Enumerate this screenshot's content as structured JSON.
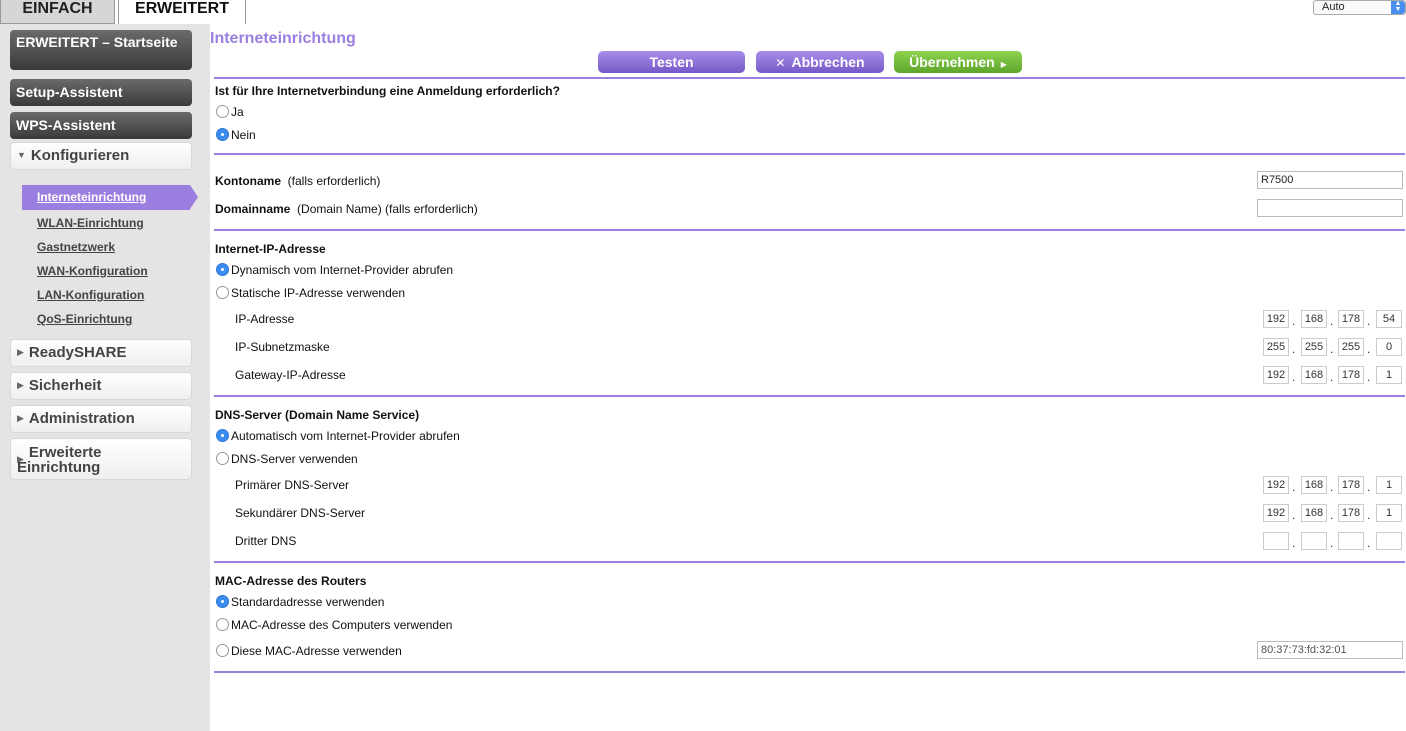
{
  "tabs": {
    "simple": "EINFACH",
    "advanced": "ERWEITERT"
  },
  "lang_select": {
    "value": "Auto"
  },
  "sidebar": {
    "home": "ERWEITERT – Startseite",
    "setup": "Setup-Assistent",
    "wps": "WPS-Assistent",
    "configure": "Konfigurieren",
    "sub": [
      "Interneteinrichtung",
      "WLAN-Einrichtung",
      "Gastnetzwerk",
      "WAN-Konfiguration",
      "LAN-Konfiguration",
      "QoS-Einrichtung"
    ],
    "readyshare": "ReadySHARE",
    "security": "Sicherheit",
    "admin": "Administration",
    "advanced_setup": "Erweiterte Einrichtung"
  },
  "page": {
    "title": "Interneteinrichtung",
    "btn_test": "Testen",
    "btn_cancel": "Abbrechen",
    "btn_apply": "Übernehmen",
    "login_q": "Ist für Ihre Internetverbindung eine Anmeldung erforderlich?",
    "yes": "Ja",
    "no": "Nein",
    "account_label": "Kontoname",
    "account_hint": "(falls erforderlich)",
    "account_value": "R7500",
    "domain_label": "Domainname",
    "domain_hint": "(Domain Name) (falls erforderlich)",
    "domain_value": "",
    "ip_title": "Internet-IP-Adresse",
    "ip_dynamic": "Dynamisch vom Internet-Provider abrufen",
    "ip_static": "Statische IP-Adresse verwenden",
    "ip_addr_label": "IP-Adresse",
    "ip_addr": [
      "192",
      "168",
      "178",
      "54"
    ],
    "ip_mask_label": "IP-Subnetzmaske",
    "ip_mask": [
      "255",
      "255",
      "255",
      "0"
    ],
    "gw_label": "Gateway-IP-Adresse",
    "gw": [
      "192",
      "168",
      "178",
      "1"
    ],
    "dns_title": "DNS-Server (Domain Name Service)",
    "dns_auto": "Automatisch vom Internet-Provider abrufen",
    "dns_manual": "DNS-Server verwenden",
    "dns1_label": "Primärer DNS-Server",
    "dns1": [
      "192",
      "168",
      "178",
      "1"
    ],
    "dns2_label": "Sekundärer DNS-Server",
    "dns2": [
      "192",
      "168",
      "178",
      "1"
    ],
    "dns3_label": "Dritter DNS",
    "dns3": [
      "",
      "",
      "",
      ""
    ],
    "mac_title": "MAC-Adresse des Routers",
    "mac_default": "Standardadresse verwenden",
    "mac_computer": "MAC-Adresse des Computers verwenden",
    "mac_custom": "Diese MAC-Adresse verwenden",
    "mac_value": "80:37:73:fd:32:01"
  }
}
